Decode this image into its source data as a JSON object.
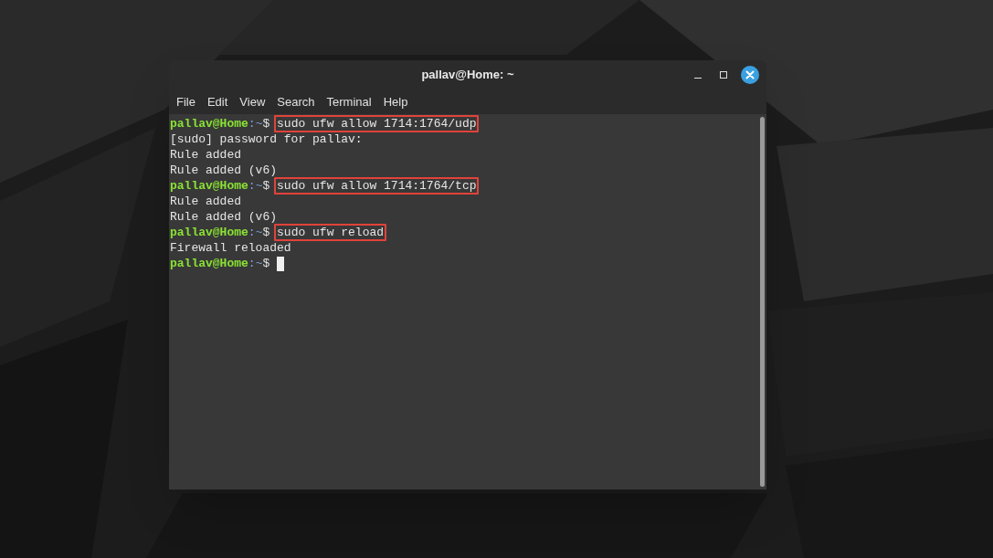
{
  "window": {
    "title": "pallav@Home: ~"
  },
  "menu": [
    "File",
    "Edit",
    "View",
    "Search",
    "Terminal",
    "Help"
  ],
  "terminal_lines": [
    {
      "kind": "prompt",
      "user": "pallav@Home",
      "path": ":~",
      "symbol": "$",
      "command": "sudo ufw allow 1714:1764/udp",
      "highlighted": true,
      "cursor": false
    },
    {
      "kind": "output",
      "text": "[sudo] password for pallav:"
    },
    {
      "kind": "output",
      "text": "Rule added"
    },
    {
      "kind": "output",
      "text": "Rule added (v6)"
    },
    {
      "kind": "prompt",
      "user": "pallav@Home",
      "path": ":~",
      "symbol": "$",
      "command": "sudo ufw allow 1714:1764/tcp",
      "highlighted": true,
      "cursor": false
    },
    {
      "kind": "output",
      "text": "Rule added"
    },
    {
      "kind": "output",
      "text": "Rule added (v6)"
    },
    {
      "kind": "prompt",
      "user": "pallav@Home",
      "path": ":~",
      "symbol": "$",
      "command": "sudo ufw reload",
      "highlighted": true,
      "cursor": false
    },
    {
      "kind": "output",
      "text": "Firewall reloaded"
    },
    {
      "kind": "prompt",
      "user": "pallav@Home",
      "path": ":~",
      "symbol": "$",
      "cursor": true
    }
  ]
}
